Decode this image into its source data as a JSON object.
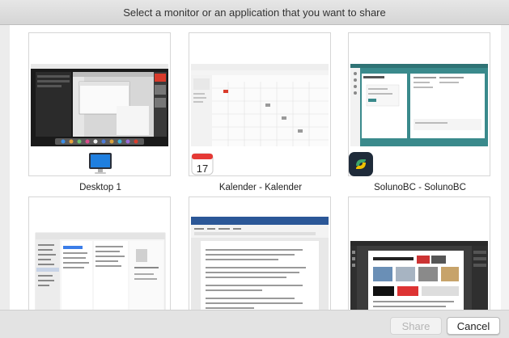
{
  "dialog": {
    "title": "Select a monitor or an application that you want to share"
  },
  "tiles": [
    {
      "label": "Desktop 1",
      "icon": "monitor-icon"
    },
    {
      "label": "Kalender - Kalender",
      "icon": "calendar-icon",
      "icon_text": "17"
    },
    {
      "label": "SolunoBC - SolunoBC",
      "icon": "solunobc-icon"
    },
    {
      "label": "",
      "icon": ""
    },
    {
      "label": "",
      "icon": ""
    },
    {
      "label": "",
      "icon": ""
    }
  ],
  "buttons": {
    "share": "Share",
    "cancel": "Cancel"
  },
  "colors": {
    "accent_red": "#d93b2b",
    "soluno_green": "#3fa86b",
    "soluno_yellow": "#f2c200"
  }
}
